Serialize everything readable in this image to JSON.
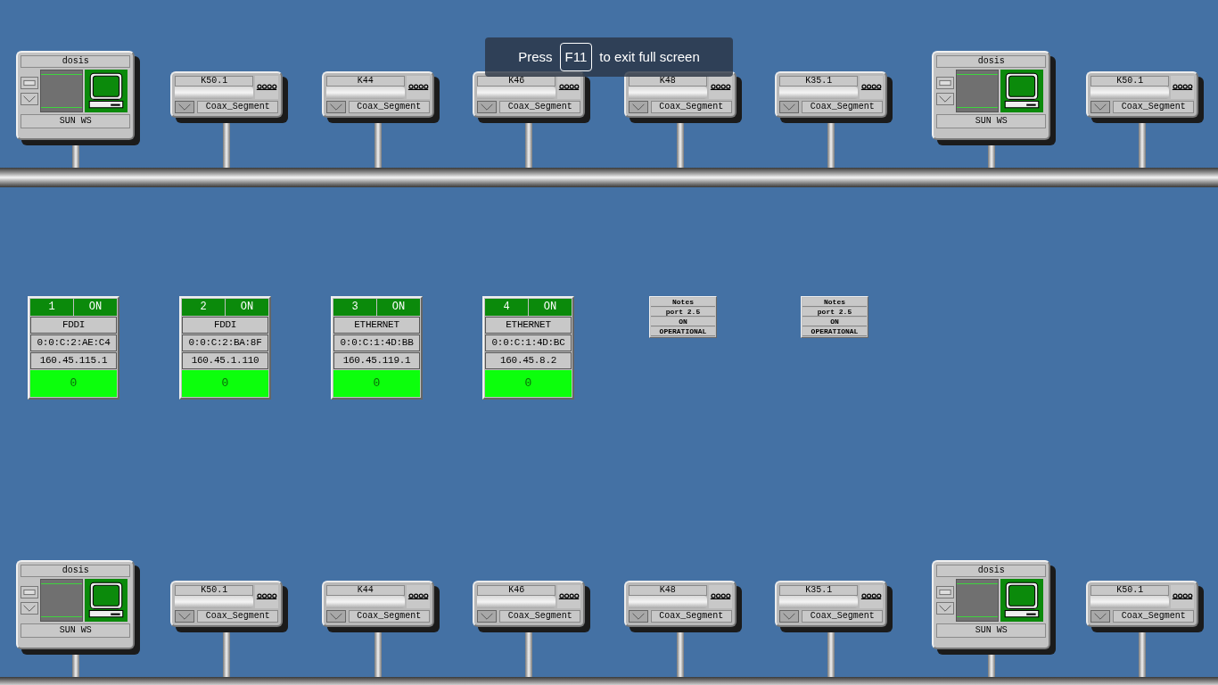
{
  "toast": {
    "before": "Press",
    "key": "F11",
    "after": "to exit full screen"
  },
  "top_network": {
    "nodes": [
      {
        "kind": "workstation",
        "name": "dosis",
        "type": "SUN WS"
      },
      {
        "kind": "segment",
        "name": "K50.1",
        "type": "Coax_Segment"
      },
      {
        "kind": "segment",
        "name": "K44",
        "type": "Coax_Segment"
      },
      {
        "kind": "segment",
        "name": "K46",
        "type": "Coax_Segment"
      },
      {
        "kind": "segment",
        "name": "K48",
        "type": "Coax_Segment"
      },
      {
        "kind": "segment",
        "name": "K35.1",
        "type": "Coax_Segment"
      },
      {
        "kind": "workstation",
        "name": "dosis",
        "type": "SUN WS"
      },
      {
        "kind": "segment",
        "name": "K50.1",
        "type": "Coax_Segment"
      }
    ]
  },
  "ports": [
    {
      "number": "1",
      "state": "ON",
      "type": "FDDI",
      "mac": "0:0:C:2:AE:C4",
      "ip": "160.45.115.1",
      "count": "0"
    },
    {
      "number": "2",
      "state": "ON",
      "type": "FDDI",
      "mac": "0:0:C:2:BA:8F",
      "ip": "160.45.1.110",
      "count": "0"
    },
    {
      "number": "3",
      "state": "ON",
      "type": "ETHERNET",
      "mac": "0:0:C:1:4D:BB",
      "ip": "160.45.119.1",
      "count": "0"
    },
    {
      "number": "4",
      "state": "ON",
      "type": "ETHERNET",
      "mac": "0:0:C:1:4D:BC",
      "ip": "160.45.8.2",
      "count": "0"
    }
  ],
  "notes": [
    {
      "title": "Notes",
      "port": "port 2.5",
      "state": "ON",
      "status": "OPERATIONAL"
    },
    {
      "title": "Notes",
      "port": "port 2.5",
      "state": "ON",
      "status": "OPERATIONAL"
    }
  ],
  "bottom_network": {
    "nodes": [
      {
        "kind": "workstation",
        "name": "dosis",
        "type": "SUN WS"
      },
      {
        "kind": "segment",
        "name": "K50.1",
        "type": "Coax_Segment"
      },
      {
        "kind": "segment",
        "name": "K44",
        "type": "Coax_Segment"
      },
      {
        "kind": "segment",
        "name": "K46",
        "type": "Coax_Segment"
      },
      {
        "kind": "segment",
        "name": "K48",
        "type": "Coax_Segment"
      },
      {
        "kind": "segment",
        "name": "K35.1",
        "type": "Coax_Segment"
      },
      {
        "kind": "workstation",
        "name": "dosis",
        "type": "SUN WS"
      },
      {
        "kind": "segment",
        "name": "K50.1",
        "type": "Coax_Segment"
      }
    ]
  }
}
